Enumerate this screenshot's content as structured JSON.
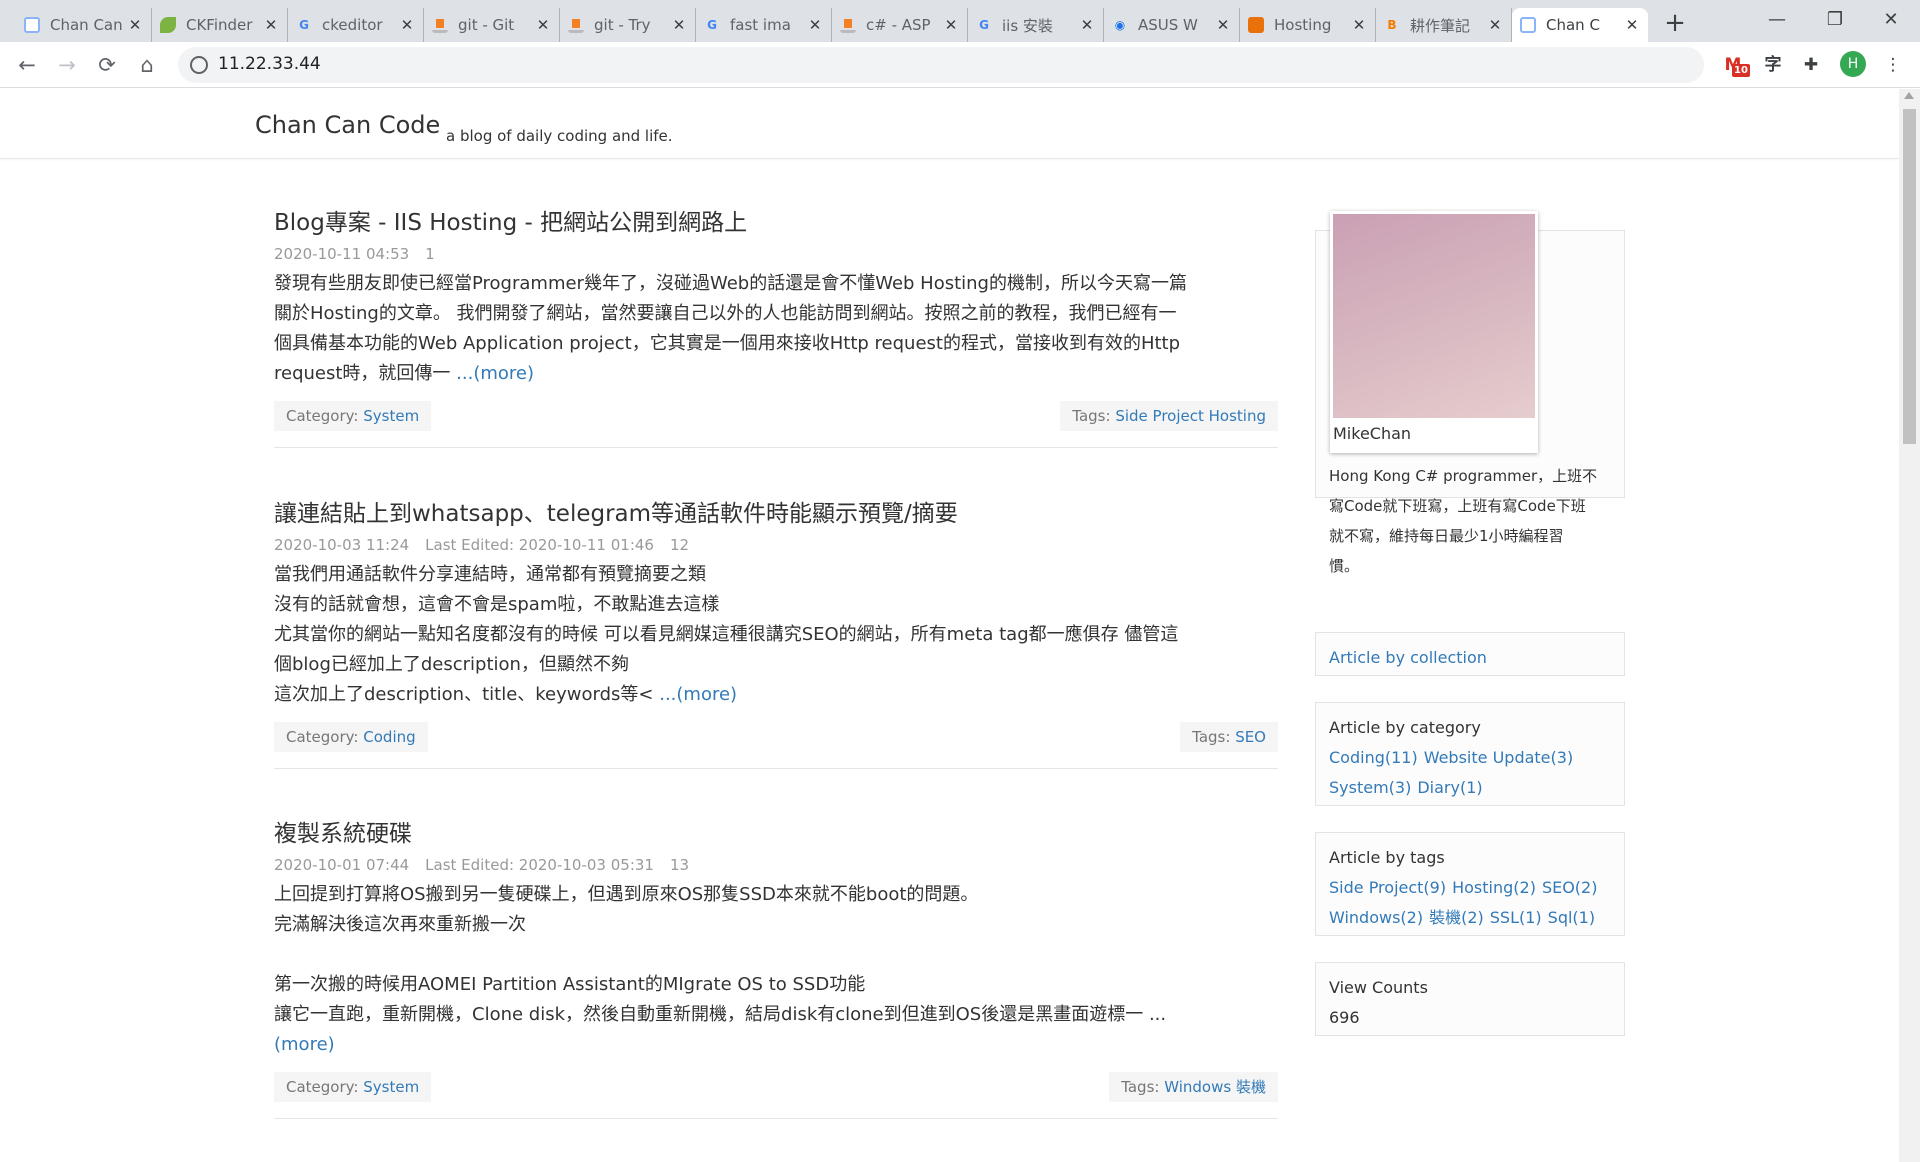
{
  "browser": {
    "tabs": [
      {
        "title": "Chan Can",
        "fav": "doc",
        "color": "#8ab4f8"
      },
      {
        "title": "CKFinder",
        "fav": "leaf",
        "color": "#7cb342"
      },
      {
        "title": "ckeditor",
        "fav": "G",
        "color": "#4285f4"
      },
      {
        "title": "git - Git",
        "fav": "so",
        "color": "#f48024"
      },
      {
        "title": "git - Try",
        "fav": "so",
        "color": "#f48024"
      },
      {
        "title": "fast ima",
        "fav": "G",
        "color": "#4285f4"
      },
      {
        "title": "c# - ASP",
        "fav": "so",
        "color": "#f48024"
      },
      {
        "title": "iis 安裝",
        "fav": "G",
        "color": "#4285f4"
      },
      {
        "title": "ASUS W",
        "fav": "wifi",
        "color": "#1a73e8"
      },
      {
        "title": "Hosting",
        "fav": "grid",
        "color": "#e8710a"
      },
      {
        "title": "耕作筆記",
        "fav": "B",
        "color": "#f57c00"
      },
      {
        "title": "Chan C",
        "fav": "doc",
        "color": "#8ab4f8"
      }
    ],
    "url": "11.22.33.44",
    "gmail_badge": "10",
    "translate_label": "字",
    "profile_initial": "H"
  },
  "site": {
    "brand": "Chan Can Code",
    "tagline": "a blog of daily coding and life."
  },
  "posts": [
    {
      "title": "Blog專案 - IIS Hosting - 把網站公開到網路上",
      "date": "2020-10-11 04:53",
      "edited": "",
      "views": "1",
      "lines": [
        "發現有些朋友即使已經當Programmer幾年了，沒碰過Web的話還是會不懂Web Hosting的機制，所以今天寫一篇",
        "關於Hosting的文章。 我們開發了網站，當然要讓自己以外的人也能訪問到網站。按照之前的教程，我們已經有一",
        "個具備基本功能的Web Application project，它其實是一個用來接收Http request的程式，當接收到有效的Http",
        "request時，就回傳一 "
      ],
      "more": "...(more)",
      "category_label": "Category:",
      "category": "System",
      "tags_label": "Tags:",
      "tags": [
        "Side Project",
        "Hosting"
      ]
    },
    {
      "title": "讓連結貼上到whatsapp、telegram等通話軟件時能顯示預覽/摘要",
      "date": "2020-10-03 11:24",
      "edited": "Last Edited: 2020-10-11 01:46",
      "views": "12",
      "lines": [
        "當我們用通話軟件分享連結時，通常都有預覽摘要之類",
        "沒有的話就會想，這會不會是spam啦，不敢點進去這樣",
        "尤其當你的網站一點知名度都沒有的時候 可以看見網媒這種很講究SEO的網站，所有meta tag都一應俱存 儘管這",
        "個blog已經加上了description，但顯然不夠",
        "這次加上了description、title、keywords等< "
      ],
      "more": "...(more)",
      "category_label": "Category:",
      "category": "Coding",
      "tags_label": "Tags:",
      "tags": [
        "SEO"
      ]
    },
    {
      "title": "複製系統硬碟",
      "date": "2020-10-01 07:44",
      "edited": "Last Edited: 2020-10-03 05:31",
      "views": "13",
      "lines": [
        "上回提到打算將OS搬到另一隻硬碟上，但遇到原來OS那隻SSD本來就不能boot的問題。",
        "完滿解決後這次再來重新搬一次",
        "",
        "第一次搬的時候用AOMEI Partition Assistant的MIgrate OS to SSD功能",
        "讓它一直跑，重新開機，Clone disk，然後自動重新開機，結局disk有clone到但進到OS後還是黑畫面遊標一 ..."
      ],
      "more": "(more)",
      "category_label": "Category:",
      "category": "System",
      "tags_label": "Tags:",
      "tags": [
        "Windows",
        "裝機"
      ]
    }
  ],
  "sidebar": {
    "profile_name": "MikeChan",
    "bio": [
      "Hong Kong C# programmer，上班不",
      "寫Code就下班寫，上班有寫Code下班",
      "就不寫，維持每日最少1小時編程習",
      "慣。"
    ],
    "collection_link": "Article by collection",
    "category_title": "Article by category",
    "categories": [
      "Coding(11)",
      "Website Update(3)",
      "System(3)",
      "Diary(1)"
    ],
    "tags_title": "Article by tags",
    "tags": [
      "Side Project(9)",
      "Hosting(2)",
      "SEO(2)",
      "Windows(2)",
      "裝機(2)",
      "SSL(1)",
      "Sql(1)"
    ],
    "views_title": "View Counts",
    "views": "696"
  }
}
